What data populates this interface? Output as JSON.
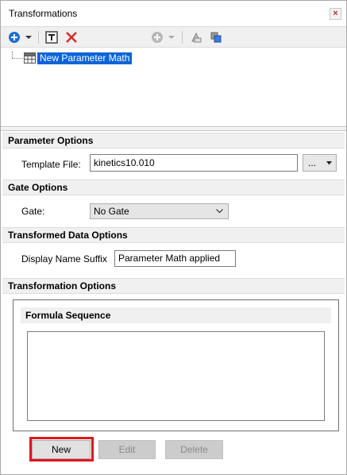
{
  "window": {
    "title": "Transformations"
  },
  "toolbar": {
    "icons": [
      "plus-circle-icon",
      "dropdown-arrow-icon",
      "text-template-icon",
      "delete-x-icon",
      "plus-circle-disabled-icon",
      "dropdown-arrow-disabled-icon",
      "layers-icon",
      "copy-layers-icon"
    ]
  },
  "tree": {
    "selected_node": "New Parameter Math"
  },
  "sections": {
    "parameter_options": "Parameter Options",
    "gate_options": "Gate Options",
    "transformed_data_options": "Transformed Data Options",
    "transformation_options": "Transformation Options"
  },
  "parameter_options": {
    "template_file_label": "Template File:",
    "template_file_value": "kinetics10.010",
    "browse_button": "..."
  },
  "gate_options": {
    "gate_label": "Gate:",
    "gate_value": "No Gate"
  },
  "transformed_data_options": {
    "suffix_label": "Display Name Suffix",
    "suffix_value": "Parameter Math applied"
  },
  "transformation_options": {
    "formula_sequence_header": "Formula Sequence",
    "formula_items": []
  },
  "buttons": {
    "new": "New",
    "edit": "Edit",
    "delete": "Delete"
  },
  "colors": {
    "selection": "#0a64d8",
    "highlight_box": "#e0141e",
    "header_bg": "#f0f0f0"
  }
}
